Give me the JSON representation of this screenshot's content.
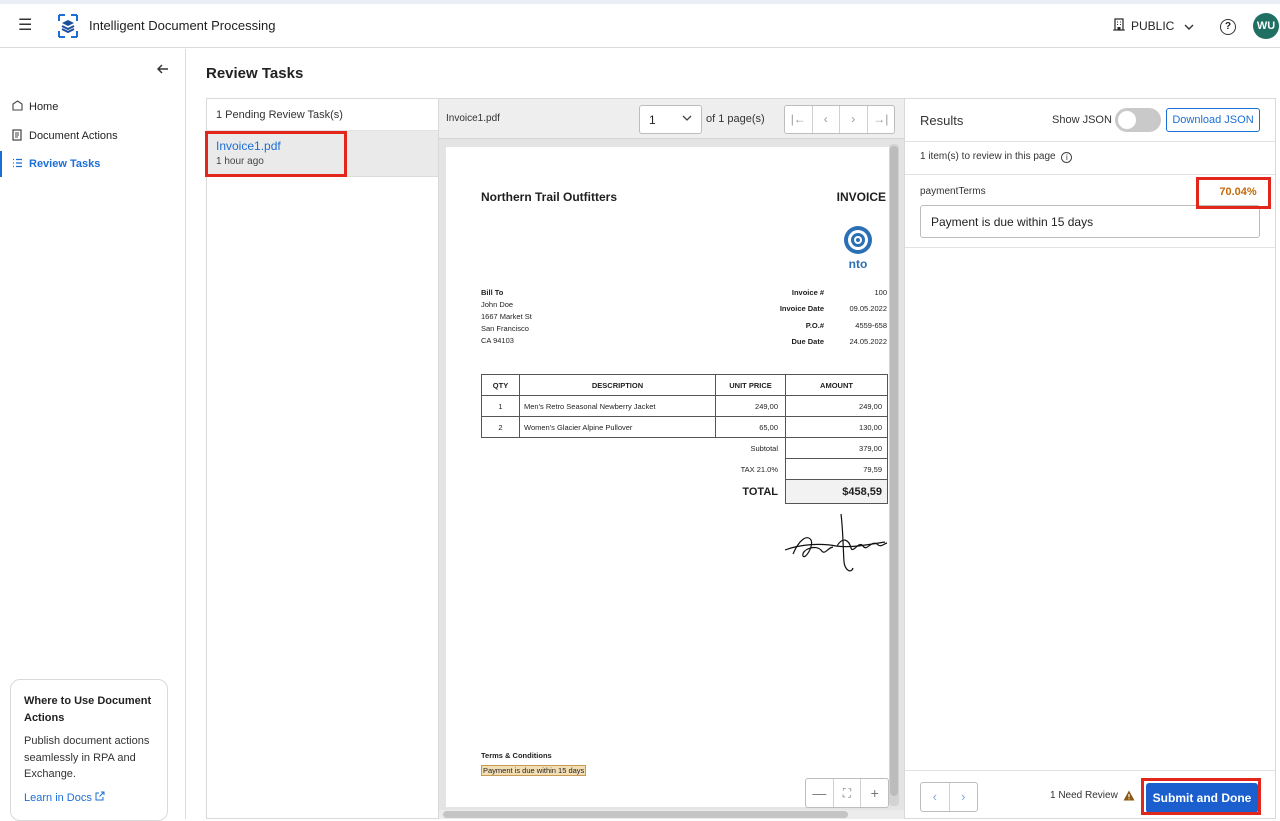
{
  "header": {
    "app_title": "Intelligent Document Processing",
    "org_label": "PUBLIC",
    "user_initials": "WU"
  },
  "sidebar": {
    "items": [
      {
        "label": "Home",
        "icon": "home-icon"
      },
      {
        "label": "Document Actions",
        "icon": "document-icon"
      },
      {
        "label": "Review Tasks",
        "icon": "list-icon"
      }
    ],
    "promo": {
      "title": "Where to Use Document Actions",
      "body": "Publish document actions seamlessly in RPA and Exchange.",
      "link": "Learn in Docs"
    }
  },
  "page": {
    "title": "Review Tasks"
  },
  "tasks": {
    "header": "1 Pending Review Task(s)",
    "items": [
      {
        "name": "Invoice1.pdf",
        "time": "1 hour ago"
      }
    ]
  },
  "viewer": {
    "file_name": "Invoice1.pdf",
    "page_value": "1",
    "page_of": "of 1 page(s)"
  },
  "document": {
    "company": "Northern Trail Outfitters",
    "doc_type": "INVOICE",
    "logo_text": "nto",
    "bill_to_label": "Bill To",
    "bill_to_lines": [
      "John Doe",
      "1667 Market St",
      "San Francisco",
      "CA 94103"
    ],
    "meta": [
      {
        "label": "Invoice #",
        "value": "100"
      },
      {
        "label": "Invoice Date",
        "value": "09.05.2022"
      },
      {
        "label": "P.O.#",
        "value": "4559-658"
      },
      {
        "label": "Due Date",
        "value": "24.05.2022"
      }
    ],
    "table_headers": [
      "QTY",
      "DESCRIPTION",
      "UNIT PRICE",
      "AMOUNT"
    ],
    "rows": [
      {
        "qty": "1",
        "desc": "Men's Retro Seasonal Newberry Jacket",
        "unit": "249,00",
        "amount": "249,00"
      },
      {
        "qty": "2",
        "desc": "Women's Glacier Alpine Pullover",
        "unit": "65,00",
        "amount": "130,00"
      }
    ],
    "subtotal_label": "Subtotal",
    "subtotal_value": "379,00",
    "tax_label": "TAX 21.0%",
    "tax_value": "79,59",
    "total_label": "TOTAL",
    "total_value": "$458,59",
    "terms_heading": "Terms & Conditions",
    "terms_text": "Payment is due within 15 days"
  },
  "results": {
    "title": "Results",
    "show_json_label": "Show JSON",
    "show_json_on": false,
    "download_label": "Download JSON",
    "review_info": "1 item(s) to review in this page",
    "field_label": "paymentTerms",
    "field_score": "70.04%",
    "field_value": "Payment is due within 15 days",
    "need_review": "1 Need Review",
    "submit_label": "Submit and Done"
  },
  "colors": {
    "accent": "#1b6fd6",
    "highlight_border": "#e3261b",
    "score": "#c56a0a",
    "submit": "#1b5fce",
    "avatar": "#1f6f63"
  }
}
